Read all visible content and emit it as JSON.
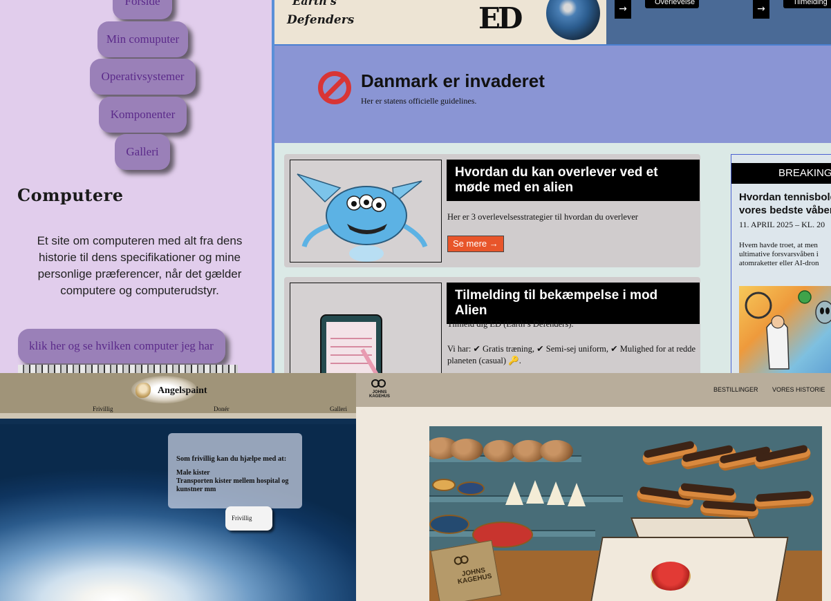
{
  "panel_a": {
    "nav": [
      "Forside",
      "Min comuputer",
      "Operativsystemer",
      "Komponenter",
      "Galleri"
    ],
    "title": "Computere",
    "description": "Et site om computeren med alt fra dens historie til dens specifikationer og mine personlige præferencer, når det gælder computere og computerudstyr.",
    "cta": "klik her og se hvilken computer jeg har"
  },
  "panel_b": {
    "logo_line1": "Earth's",
    "logo_line2": "Defenders",
    "logo_mark": "ED",
    "top_tabs": [
      "Overlevelse",
      "Tilmelding"
    ],
    "arrow": "→",
    "hero_title": "Danmark er invaderet",
    "hero_subtitle": "Her er statens officielle guidelines.",
    "card1": {
      "title": "Hvordan du kan overlever ved et møde med en alien",
      "text": "Her er 3 overlevelsesstrategier til hvordan du overlever",
      "button": "Se mere →"
    },
    "card2": {
      "title": "Tilmelding til bekæmpelse i mod Alien",
      "text1": "Tilmeld dig ED (Earth’s Defenders).",
      "text2": "Vi har: ✔ Gratis træning, ✔ Semi-sej uniform, ✔ Mulighed for at redde planeten (casual) 🔑."
    },
    "breaking": {
      "label": "BREAKING",
      "title_line1": "Hvordan tennisbold",
      "title_line2": "vores bedste våben",
      "date": "11. APRIL 2025 – KL. 20",
      "text_line1": "Hvem havde troet, at men",
      "text_line2": "ultimative forsvarsvåben i",
      "text_line3": "atomraketter eller AI-dron"
    }
  },
  "panel_c": {
    "brand": "Angelspaint",
    "nav": [
      "Frivillig",
      "Donér",
      "Galleri"
    ],
    "info_heading": "Som frivillig kan du hjælpe med at:",
    "info_lines": [
      "Male kister",
      "Transporten kister mellem hospital og kunstner mm"
    ],
    "button": "Frivillig"
  },
  "panel_d": {
    "logo_text_line1": "JOHNS",
    "logo_text_line2": "KAGEHUS",
    "nav": [
      "BESTILLINGER",
      "VORES HISTORIE"
    ],
    "bag_text": "JOHNS KAGEHUS"
  }
}
